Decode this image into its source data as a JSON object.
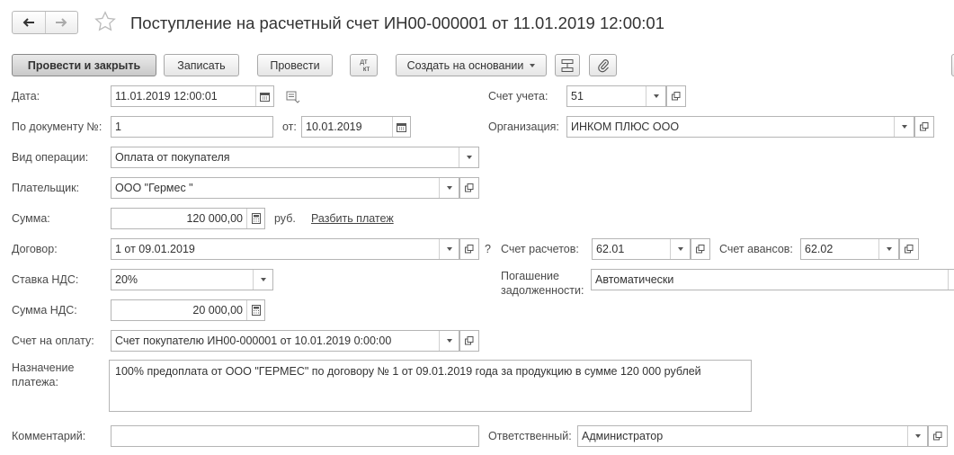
{
  "header": {
    "title": "Поступление на расчетный счет ИН00-000001 от 11.01.2019 12:00:01"
  },
  "toolbar": {
    "post_close": "Провести и закрыть",
    "save": "Записать",
    "post": "Провести",
    "dtkt_top": "дт",
    "dtkt_bottom": "кт",
    "create_based": "Создать на основании"
  },
  "form": {
    "date_label": "Дата:",
    "date_value": "11.01.2019 12:00:01",
    "doc_no_label": "По документу №:",
    "doc_no_value": "1",
    "doc_from_label": "от:",
    "doc_from_value": "10.01.2019",
    "op_type_label": "Вид операции:",
    "op_type_value": "Оплата от покупателя",
    "payer_label": "Плательщик:",
    "payer_value": "ООО \"Гермес \"",
    "sum_label": "Сумма:",
    "sum_value": "120 000,00",
    "currency": "руб.",
    "split_link": "Разбить платеж",
    "contract_label": "Договор:",
    "contract_value": "1 от 09.01.2019",
    "question": "?",
    "vat_rate_label": "Ставка НДС:",
    "vat_rate_value": "20%",
    "vat_sum_label": "Сумма НДС:",
    "vat_sum_value": "20 000,00",
    "invoice_label": "Счет на оплату:",
    "invoice_value": "Счет покупателю ИН00-000001 от 10.01.2019 0:00:00",
    "purpose_label_1": "Назначение",
    "purpose_label_2": "платежа:",
    "purpose_value": "100% предоплата от ООО \"ГЕРМЕС\" по договору № 1 от 09.01.2019 года за продукцию в сумме 120 000 рублей",
    "comment_label": "Комментарий:",
    "comment_value": "",
    "account_label": "Счет учета:",
    "account_value": "51",
    "org_label": "Организация:",
    "org_value": "ИНКОМ ПЛЮС ООО",
    "settle_label": "Счет расчетов:",
    "settle_value": "62.01",
    "advance_label": "Счет авансов:",
    "advance_value": "62.02",
    "repay_label_1": "Погашение",
    "repay_label_2": "задолженности:",
    "repay_value": "Автоматически",
    "resp_label": "Ответственный:",
    "resp_value": "Администратор"
  }
}
